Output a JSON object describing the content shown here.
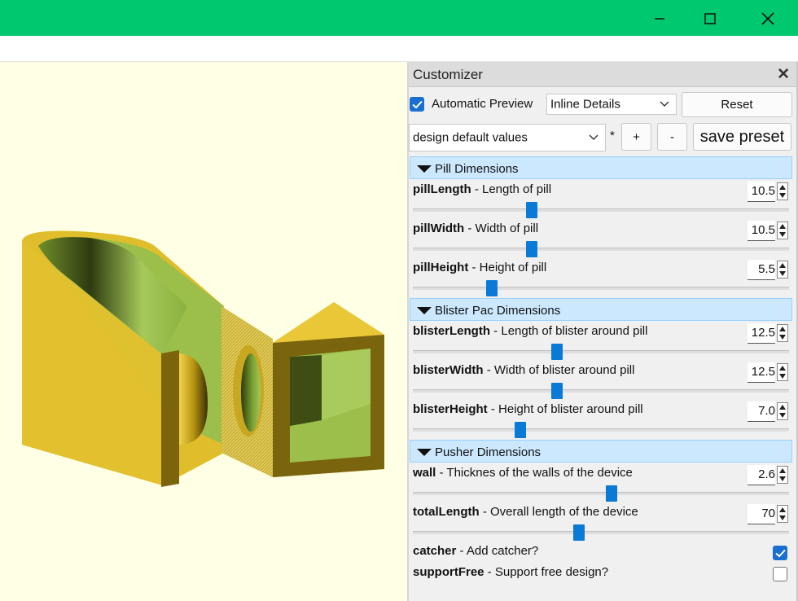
{
  "panel": {
    "title": "Customizer",
    "automatic_preview_label": "Automatic Preview",
    "automatic_preview_checked": true,
    "view_mode": "Inline Details",
    "reset_label": "Reset",
    "preset": "design default values",
    "preset_modified_marker": "*",
    "add_preset_label": "+",
    "remove_preset_label": "-",
    "save_preset_label": "save preset"
  },
  "groups": [
    {
      "title": "Pill Dimensions",
      "params": [
        {
          "name": "pillLength",
          "desc": " - Length of pill",
          "value": "10.5",
          "slider": 0.31
        },
        {
          "name": "pillWidth",
          "desc": " - Width of pill",
          "value": "10.5",
          "slider": 0.31
        },
        {
          "name": "pillHeight",
          "desc": " - Height of pill",
          "value": "5.5",
          "slider": 0.2
        }
      ]
    },
    {
      "title": "Blister Pac Dimensions",
      "params": [
        {
          "name": "blisterLength",
          "desc": " - Length of blister around pill",
          "value": "12.5",
          "slider": 0.38
        },
        {
          "name": "blisterWidth",
          "desc": " - Width of blister around pill",
          "value": "12.5",
          "slider": 0.38
        },
        {
          "name": "blisterHeight",
          "desc": " - Height of blister around pill",
          "value": "7.0",
          "slider": 0.28
        }
      ]
    },
    {
      "title": "Pusher Dimensions",
      "params": [
        {
          "name": "wall",
          "desc": " - Thicknes of the walls of the device",
          "value": "2.6",
          "slider": 0.53
        },
        {
          "name": "totalLength",
          "desc": " - Overall length of the device",
          "value": "70",
          "slider": 0.44
        }
      ],
      "checks": [
        {
          "name": "catcher",
          "desc": " - Add catcher?",
          "checked": true
        },
        {
          "name": "supportFree",
          "desc": " - Support free design?",
          "checked": false
        }
      ]
    }
  ],
  "colors": {
    "titlebar": "#00c86e",
    "viewport_background": "#ffffe5",
    "model_yellow": "#e8c32e",
    "model_green": "#9bbf4a",
    "accent": "#0a7ad6",
    "group_header": "#cce8ff"
  },
  "icons": [
    "minimize-icon",
    "maximize-icon",
    "close-icon",
    "chevron-down-icon",
    "check-icon",
    "collapse-triangle-icon",
    "spin-up-icon",
    "spin-down-icon"
  ]
}
